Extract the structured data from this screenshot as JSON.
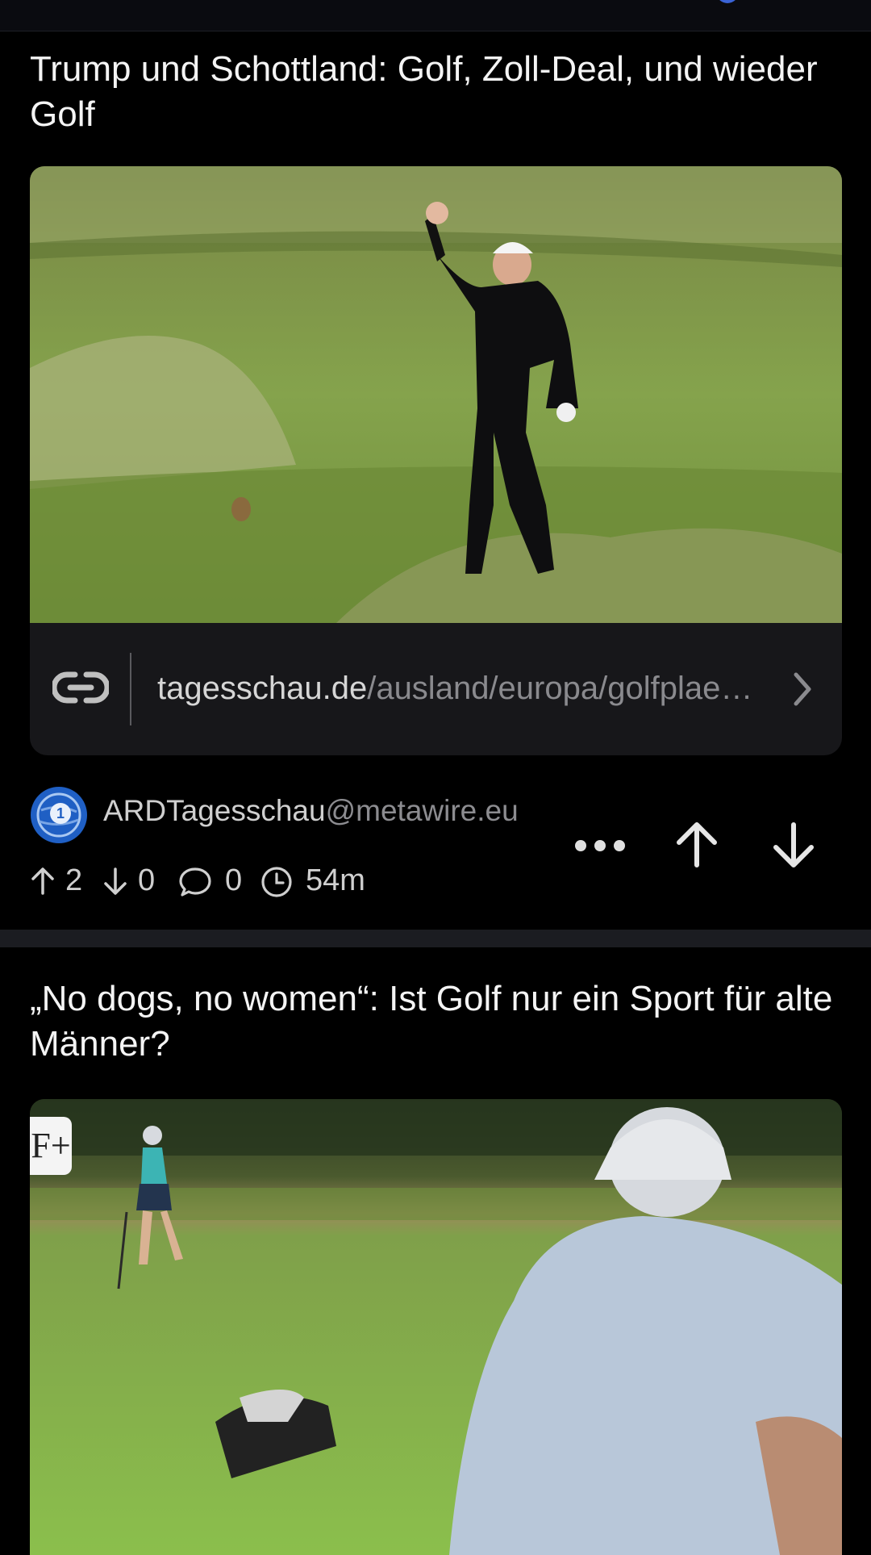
{
  "posts": [
    {
      "title": "Trump und Schottland: Golf, Zoll-Deal, und wieder Golf",
      "link": {
        "domain": "tagesschau.de",
        "path": "/ausland/europa/golfplae…"
      },
      "author": {
        "user": "ARDTagesschau",
        "instance": "@metawire.eu"
      },
      "stats": {
        "upvotes": "2",
        "downvotes": "0",
        "comments": "0",
        "age": "54m"
      },
      "photo_icon": "golfer-waving-photo"
    },
    {
      "title": "„No dogs, no women“: Ist Golf nur ein Sport für alte Männer?",
      "badge": "F+",
      "photo_icon": "golf-course-photo"
    }
  ],
  "icons": {
    "link": "link-icon",
    "chevron": "chevron-right-icon",
    "more": "more-dots-icon",
    "upvote": "arrow-up-icon",
    "downvote": "arrow-down-icon",
    "comment": "comment-icon",
    "clock": "clock-icon"
  },
  "colors": {
    "background": "#000000",
    "card_link_bar": "#17171a",
    "separator": "#1b1c21",
    "text_primary": "#f4f4f4",
    "text_secondary": "#8c8c90",
    "avatar_blue": "#2f6fd1"
  }
}
